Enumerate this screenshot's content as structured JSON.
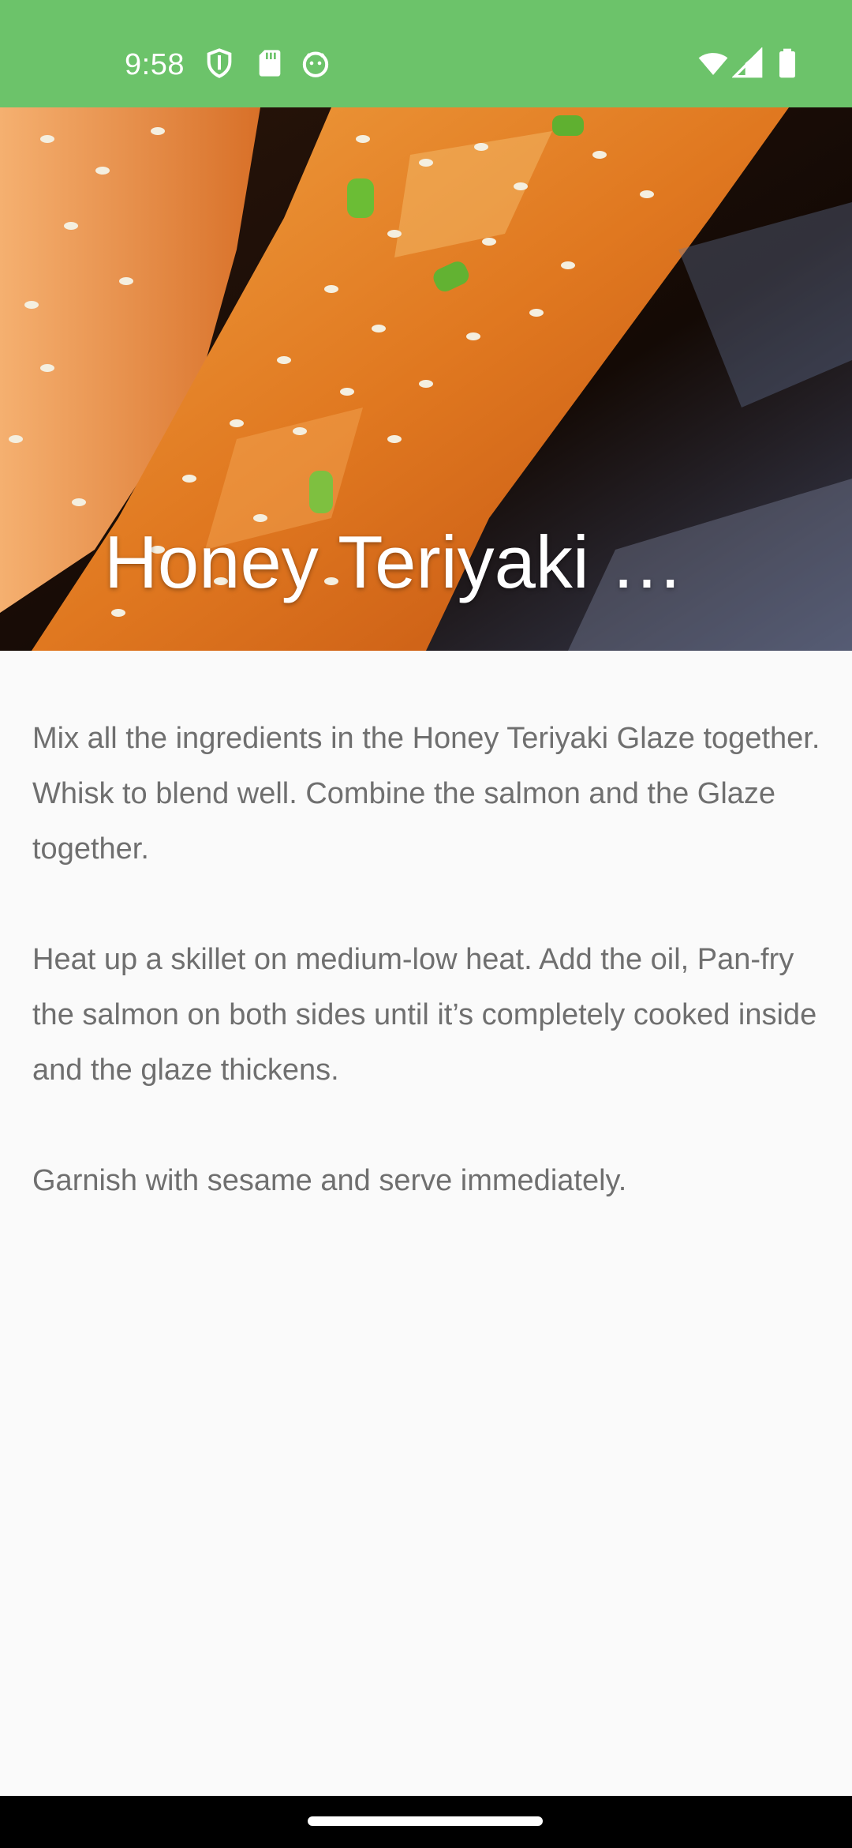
{
  "status_bar": {
    "time": "9:58",
    "background_color": "#6cc36a",
    "left_icons": [
      "shield-icon",
      "sd-card-icon",
      "android-face-icon"
    ],
    "right_icons": [
      "wifi-icon",
      "cell-signal-icon",
      "battery-icon"
    ]
  },
  "hero": {
    "title": "Honey Teriyaki S…",
    "image": "teriyaki-salmon-photo"
  },
  "instructions": {
    "steps": [
      "Mix all the ingredients in the Honey Teriyaki Glaze together. Whisk to blend well. Combine the salmon and the Glaze together.",
      "Heat up a skillet on medium-low heat. Add the oil, Pan-fry the salmon on both sides until it’s completely cooked inside and the glaze thickens.",
      "Garnish with sesame and serve immediately."
    ]
  },
  "nav_bar": {
    "background_color": "#000000",
    "handle": "home-gesture-pill"
  }
}
